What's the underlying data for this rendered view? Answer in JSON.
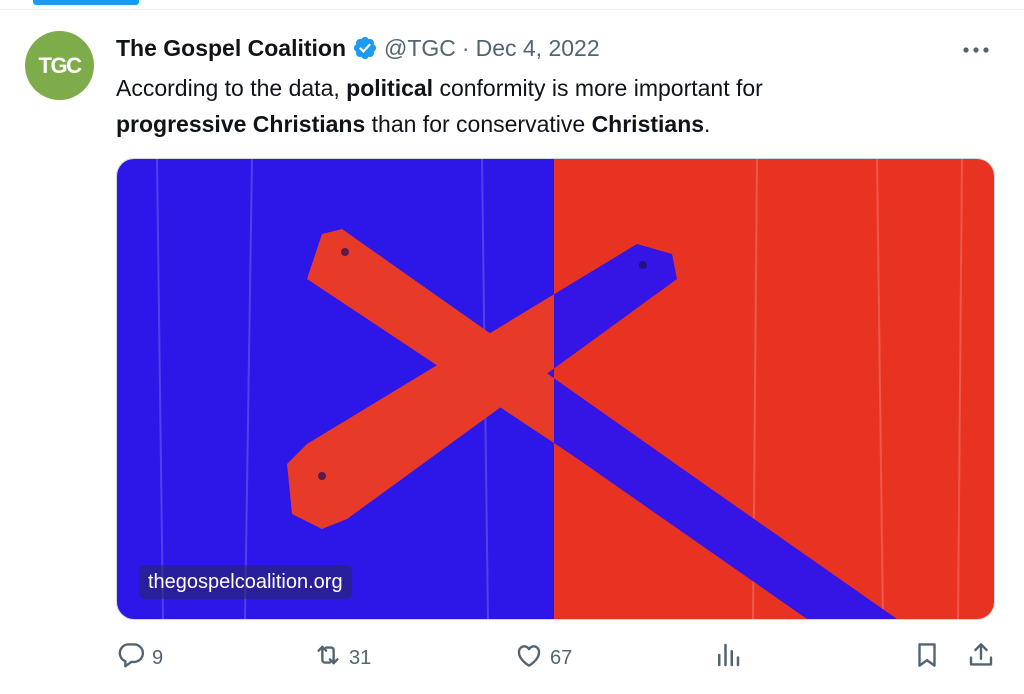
{
  "tweet": {
    "avatar_text": "TGC",
    "display_name": "The Gospel Coalition",
    "handle": "@TGC",
    "separator": "·",
    "date": "Dec 4, 2022",
    "text": {
      "p1": "According to the data, ",
      "b1": "political",
      "p2": " conformity is more important for",
      "b2": "progressive Christians",
      "p3": " than for conservative ",
      "b3": "Christians",
      "p4": "."
    },
    "media": {
      "link_label": "thegospelcoalition.org",
      "colors": {
        "left_panel": "#2d16e8",
        "right_panel": "#e83322",
        "cross_on_blue": "#e83a28",
        "cross_on_red": "#3514e6"
      }
    }
  },
  "actions": {
    "replies": "9",
    "retweets": "31",
    "likes": "67"
  },
  "icons": [
    "verified-badge-icon",
    "more-icon",
    "reply-icon",
    "retweet-icon",
    "like-icon",
    "views-icon",
    "bookmark-icon",
    "share-icon"
  ],
  "colors": {
    "accent": "#1d9bf0",
    "text": "#0f1419",
    "secondary": "#536471",
    "avatar_bg": "#7fac4a"
  }
}
